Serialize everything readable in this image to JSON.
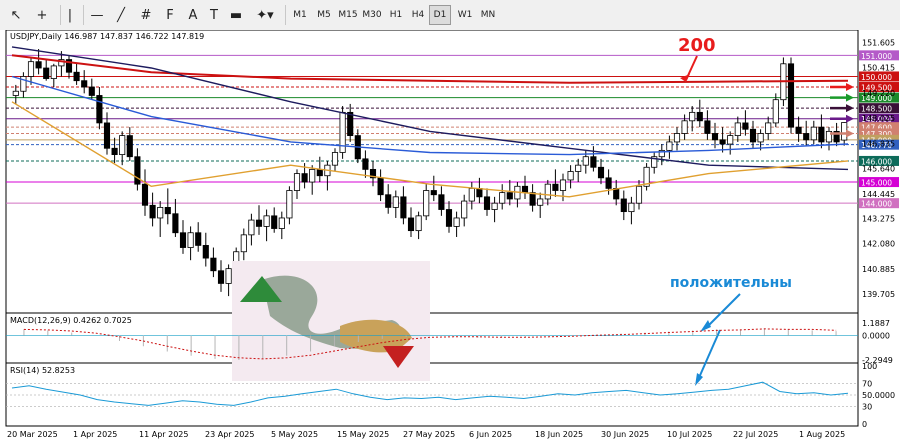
{
  "toolbar": {
    "tools": [
      {
        "name": "cursor-tool-icon",
        "glyph": "↖"
      },
      {
        "name": "crosshair-tool-icon",
        "glyph": "+"
      },
      {
        "name": "vertical-line-tool-icon",
        "glyph": "|"
      },
      {
        "name": "horizontal-line-tool-icon",
        "glyph": "—"
      },
      {
        "name": "trendline-tool-icon",
        "glyph": "╱"
      },
      {
        "name": "channel-tool-icon",
        "glyph": "#"
      },
      {
        "name": "fibonacci-tool-icon",
        "glyph": "F"
      },
      {
        "name": "text-tool-icon",
        "glyph": "A"
      },
      {
        "name": "label-tool-icon",
        "glyph": "T"
      },
      {
        "name": "rectangle-tool-icon",
        "glyph": "▬"
      },
      {
        "name": "shapes-tool-icon",
        "glyph": "✦▾"
      }
    ],
    "timeframes": [
      "M1",
      "M5",
      "M15",
      "M30",
      "H1",
      "H4",
      "D1",
      "W1",
      "MN"
    ],
    "active_timeframe": "D1"
  },
  "chart_data": [
    {
      "type": "candlestick",
      "symbol_header": "USDJPY,Daily  146.987 147.837 146.722 147.819",
      "ylim": [
        138.8,
        152.2
      ],
      "yticks": [
        151.605,
        150.415,
        149.22,
        148.025,
        146.835,
        145.64,
        144.445,
        143.275,
        142.08,
        140.885,
        139.705
      ],
      "xticks": [
        "20 Mar 2025",
        "1 Apr 2025",
        "11 Apr 2025",
        "23 Apr 2025",
        "5 May 2025",
        "15 May 2025",
        "27 May 2025",
        "6 Jun 2025",
        "18 Jun 2025",
        "30 Jun 2025",
        "10 Jul 2025",
        "22 Jul 2025",
        "1 Aug 2025"
      ],
      "candles_ohlc": [
        [
          149.1,
          149.6,
          148.7,
          149.3
        ],
        [
          149.3,
          150.2,
          149.0,
          150.0
        ],
        [
          150.0,
          150.9,
          149.6,
          150.7
        ],
        [
          150.7,
          151.3,
          150.1,
          150.4
        ],
        [
          150.4,
          150.8,
          149.8,
          149.9
        ],
        [
          149.9,
          150.6,
          149.5,
          150.5
        ],
        [
          150.5,
          151.2,
          150.0,
          150.8
        ],
        [
          150.8,
          151.0,
          149.9,
          150.2
        ],
        [
          150.2,
          150.6,
          149.6,
          149.8
        ],
        [
          149.8,
          150.3,
          149.2,
          149.5
        ],
        [
          149.5,
          149.9,
          148.9,
          149.1
        ],
        [
          149.1,
          149.5,
          147.5,
          147.8
        ],
        [
          147.8,
          148.3,
          146.3,
          146.6
        ],
        [
          146.6,
          147.1,
          145.9,
          146.3
        ],
        [
          146.3,
          147.4,
          145.8,
          147.2
        ],
        [
          147.2,
          147.6,
          146.0,
          146.2
        ],
        [
          146.2,
          146.6,
          144.6,
          144.9
        ],
        [
          144.9,
          145.6,
          143.4,
          143.9
        ],
        [
          143.9,
          144.5,
          142.9,
          143.3
        ],
        [
          143.3,
          144.1,
          142.4,
          143.8
        ],
        [
          143.8,
          144.7,
          143.0,
          143.5
        ],
        [
          143.5,
          144.2,
          142.4,
          142.6
        ],
        [
          142.6,
          143.2,
          141.6,
          141.9
        ],
        [
          141.9,
          142.9,
          141.3,
          142.6
        ],
        [
          142.6,
          143.1,
          141.7,
          142.0
        ],
        [
          142.0,
          142.6,
          141.0,
          141.4
        ],
        [
          141.4,
          141.9,
          140.5,
          140.8
        ],
        [
          140.8,
          141.3,
          139.8,
          140.2
        ],
        [
          140.2,
          141.1,
          139.6,
          140.9
        ],
        [
          140.9,
          141.9,
          140.4,
          141.7
        ],
        [
          141.7,
          142.8,
          141.3,
          142.5
        ],
        [
          142.5,
          143.5,
          142.0,
          143.2
        ],
        [
          143.2,
          143.9,
          142.5,
          142.9
        ],
        [
          142.9,
          143.7,
          142.2,
          143.4
        ],
        [
          143.4,
          143.8,
          142.6,
          142.8
        ],
        [
          142.8,
          143.6,
          142.3,
          143.3
        ],
        [
          143.3,
          144.8,
          143.0,
          144.6
        ],
        [
          144.6,
          145.6,
          144.2,
          145.4
        ],
        [
          145.4,
          145.9,
          144.7,
          145.0
        ],
        [
          145.0,
          145.8,
          144.4,
          145.6
        ],
        [
          145.6,
          146.2,
          145.0,
          145.3
        ],
        [
          145.3,
          146.0,
          144.6,
          145.8
        ],
        [
          145.8,
          146.6,
          145.5,
          146.4
        ],
        [
          146.4,
          148.6,
          146.1,
          148.3
        ],
        [
          148.3,
          148.7,
          146.9,
          147.2
        ],
        [
          147.2,
          147.5,
          145.9,
          146.1
        ],
        [
          146.1,
          146.5,
          145.2,
          145.6
        ],
        [
          145.6,
          146.0,
          144.8,
          145.2
        ],
        [
          145.2,
          145.6,
          144.1,
          144.4
        ],
        [
          144.4,
          144.9,
          143.5,
          143.8
        ],
        [
          143.8,
          144.6,
          143.3,
          144.3
        ],
        [
          144.3,
          144.8,
          143.0,
          143.3
        ],
        [
          143.3,
          143.8,
          142.4,
          142.7
        ],
        [
          142.7,
          143.6,
          142.3,
          143.4
        ],
        [
          143.4,
          144.9,
          143.2,
          144.6
        ],
        [
          144.6,
          145.3,
          144.1,
          144.4
        ],
        [
          144.4,
          144.8,
          143.4,
          143.7
        ],
        [
          143.7,
          144.1,
          142.6,
          142.9
        ],
        [
          142.9,
          143.6,
          142.4,
          143.3
        ],
        [
          143.3,
          144.4,
          142.9,
          144.1
        ],
        [
          144.1,
          145.0,
          143.7,
          144.7
        ],
        [
          144.7,
          145.2,
          144.0,
          144.3
        ],
        [
          144.3,
          144.7,
          143.4,
          143.7
        ],
        [
          143.7,
          144.3,
          143.1,
          144.0
        ],
        [
          144.0,
          144.9,
          143.7,
          144.5
        ],
        [
          144.5,
          145.1,
          143.9,
          144.2
        ],
        [
          144.2,
          145.0,
          143.8,
          144.8
        ],
        [
          144.8,
          145.3,
          144.2,
          144.5
        ],
        [
          144.5,
          144.9,
          143.6,
          143.9
        ],
        [
          143.9,
          144.5,
          143.3,
          144.2
        ],
        [
          144.2,
          145.1,
          143.9,
          144.9
        ],
        [
          144.9,
          145.6,
          144.3,
          144.6
        ],
        [
          144.6,
          145.4,
          144.1,
          145.1
        ],
        [
          145.1,
          145.8,
          144.7,
          145.5
        ],
        [
          145.5,
          146.1,
          145.0,
          145.8
        ],
        [
          145.8,
          146.5,
          145.4,
          146.2
        ],
        [
          146.2,
          146.7,
          145.5,
          145.7
        ],
        [
          145.7,
          146.1,
          144.9,
          145.2
        ],
        [
          145.2,
          145.6,
          144.4,
          144.7
        ],
        [
          144.7,
          145.1,
          143.9,
          144.2
        ],
        [
          144.2,
          144.6,
          143.2,
          143.6
        ],
        [
          143.6,
          144.3,
          143.0,
          144.0
        ],
        [
          144.0,
          145.1,
          143.7,
          144.8
        ],
        [
          144.8,
          145.9,
          144.6,
          145.7
        ],
        [
          145.7,
          146.4,
          145.4,
          146.2
        ],
        [
          146.2,
          146.8,
          145.8,
          146.5
        ],
        [
          146.5,
          147.2,
          146.1,
          146.9
        ],
        [
          146.9,
          147.6,
          146.5,
          147.3
        ],
        [
          147.3,
          148.2,
          147.0,
          147.9
        ],
        [
          147.9,
          148.6,
          147.4,
          148.3
        ],
        [
          148.3,
          148.9,
          147.6,
          147.9
        ],
        [
          147.9,
          148.4,
          147.0,
          147.3
        ],
        [
          147.3,
          147.8,
          146.6,
          147.0
        ],
        [
          147.0,
          147.6,
          146.4,
          146.8
        ],
        [
          146.8,
          147.4,
          146.3,
          147.2
        ],
        [
          147.2,
          148.1,
          146.9,
          147.8
        ],
        [
          147.8,
          148.4,
          147.2,
          147.5
        ],
        [
          147.5,
          147.9,
          146.6,
          146.9
        ],
        [
          146.9,
          147.5,
          146.5,
          147.3
        ],
        [
          147.3,
          148.1,
          147.0,
          147.8
        ],
        [
          147.8,
          149.2,
          147.6,
          148.9
        ],
        [
          148.9,
          150.9,
          148.6,
          150.6
        ],
        [
          150.6,
          150.9,
          147.3,
          147.6
        ],
        [
          147.6,
          148.1,
          146.9,
          147.3
        ],
        [
          147.3,
          147.9,
          146.7,
          147.0
        ],
        [
          147.0,
          147.9,
          146.8,
          147.6
        ],
        [
          147.6,
          148.2,
          146.6,
          146.9
        ],
        [
          146.9,
          147.6,
          146.5,
          147.4
        ],
        [
          147.4,
          147.8,
          146.7,
          146.9
        ],
        [
          146.987,
          147.837,
          146.722,
          147.819
        ]
      ],
      "moving_averages": [
        {
          "period": 200,
          "label": "200",
          "color": "#cc1111",
          "values": [
            151.0,
            150.2,
            149.9,
            149.8,
            149.7,
            149.75,
            149.8
          ]
        },
        {
          "period": 100,
          "color": "#1d1b5e",
          "values": [
            151.4,
            150.4,
            148.8,
            147.4,
            146.6,
            145.8,
            145.6
          ]
        },
        {
          "period": 50,
          "color": "#2a5bd7",
          "values": [
            150.0,
            148.1,
            146.9,
            146.4,
            146.3,
            146.5,
            146.8
          ]
        },
        {
          "period": 20,
          "color": "#e0a030",
          "values": [
            148.8,
            144.8,
            145.8,
            144.9,
            144.3,
            145.4,
            146.0
          ]
        }
      ],
      "levels": [
        {
          "value": 151.0,
          "label": "151.000",
          "color": "#b45ac8"
        },
        {
          "value": 150.0,
          "label": "150.000",
          "color": "#cc1111"
        },
        {
          "value": 149.5,
          "label": "149.500",
          "color": "#cc1111"
        },
        {
          "value": 149.0,
          "label": "149.000",
          "color": "#1a8a2a"
        },
        {
          "value": 148.5,
          "label": "148.500",
          "color": "#3a1038"
        },
        {
          "value": 148.0,
          "label": "148.000",
          "color": "#6a1a8a"
        },
        {
          "value": 147.6,
          "label": "147.600",
          "color": "#d08070"
        },
        {
          "value": 147.3,
          "label": "147.300",
          "color": "#d08070"
        },
        {
          "value": 147.0,
          "label": "147.000",
          "color": "#c0a060"
        },
        {
          "value": 146.77,
          "label": "146.770",
          "color": "#3060c0"
        },
        {
          "value": 146.0,
          "label": "146.000",
          "color": "#0d6b5a"
        },
        {
          "value": 145.0,
          "label": "145.000",
          "color": "#d400d4"
        },
        {
          "value": 144.0,
          "label": "144.000",
          "color": "#d070c0"
        }
      ],
      "annotations": {
        "ma_label": "200",
        "note": "положительны"
      }
    },
    {
      "type": "histogram",
      "title": "MACD(12,26,9) 0.4262 0.7025",
      "yticks": [
        "1.1887",
        "0.0000",
        "-2.2949"
      ],
      "ylim": [
        -2.4,
        1.3
      ],
      "macd": [
        0.6,
        0.5,
        0.3,
        0.0,
        -0.5,
        -1.0,
        -1.5,
        -1.9,
        -2.2,
        -2.3,
        -2.2,
        -1.9,
        -1.5,
        -1.0,
        -0.6,
        -0.3,
        -0.1,
        0.0,
        -0.1,
        -0.2,
        -0.2,
        -0.1,
        0.0,
        0.0,
        0.1,
        0.2,
        0.3,
        0.4,
        0.5,
        0.6,
        0.6,
        0.7,
        0.6,
        0.5,
        0.43
      ],
      "signal_color": "#cc1111",
      "hist_color": "#b4b4b4"
    },
    {
      "type": "line",
      "title": "RSI(14) 52.8253",
      "yticks": [
        "100",
        "70",
        "50.0000",
        "30",
        "0"
      ],
      "ylim": [
        0,
        100
      ],
      "color": "#1a9ad6",
      "values": [
        62,
        66,
        60,
        55,
        50,
        42,
        38,
        35,
        32,
        36,
        40,
        38,
        34,
        32,
        38,
        45,
        48,
        52,
        56,
        60,
        52,
        46,
        42,
        45,
        44,
        46,
        42,
        45,
        48,
        46,
        44,
        48,
        52,
        50,
        54,
        56,
        58,
        54,
        50,
        52,
        55,
        58,
        60,
        66,
        72,
        56,
        52,
        54,
        50,
        53
      ]
    }
  ],
  "colors": {
    "bull_candle": "#ffffff",
    "bear_candle": "#000000",
    "arrow_red": "#e81c1c",
    "arrow_green": "#1a9a2a",
    "arrow_dark": "#3a1038",
    "arrow_purple": "#6a1a8a",
    "arrow_pink": "#d08070",
    "annotation_blue": "#1a8ad6"
  }
}
